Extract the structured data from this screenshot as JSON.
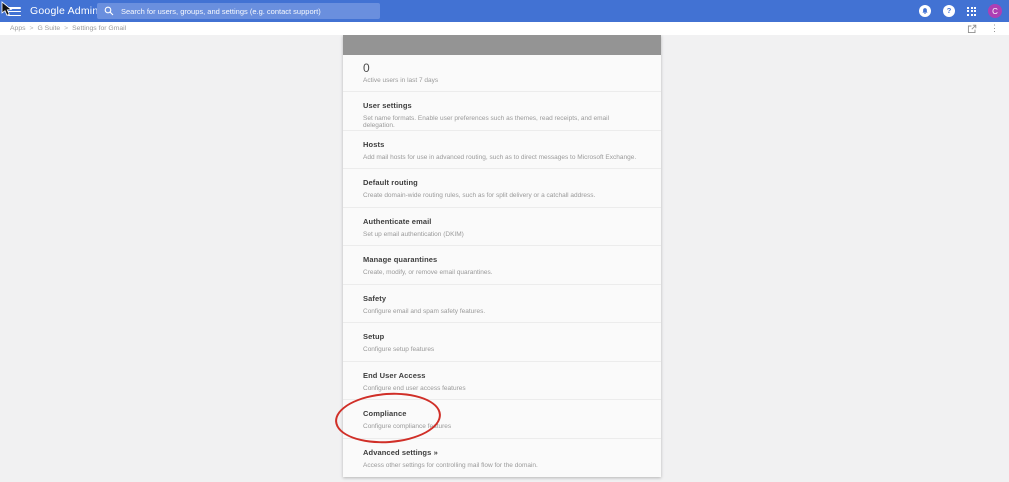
{
  "colors": {
    "header_bg": "#4272d3",
    "search_bg": "#6a8fde",
    "avatar_bg": "#ae3fb4",
    "card_topbar": "#949494",
    "page_bg": "#f1f1f2",
    "card_bg": "#fafafa",
    "annotation": "#d02f28"
  },
  "header": {
    "product_name": "Google Admin",
    "search": {
      "placeholder": "Search for users, groups, and settings (e.g. contact support)"
    },
    "avatar_letter": "C"
  },
  "icons": {
    "help_glyph": "?",
    "kebab_glyph": "⋮"
  },
  "breadcrumb": {
    "separator": ">",
    "items": [
      "Apps",
      "G Suite",
      "Settings for Gmail"
    ]
  },
  "stats": {
    "value": "0",
    "label": "Active users in last 7 days"
  },
  "sections": [
    {
      "id": "user-settings",
      "title": "User settings",
      "description": "Set name formats. Enable user preferences such as themes, read receipts, and email delegation.",
      "annotated": false
    },
    {
      "id": "hosts",
      "title": "Hosts",
      "description": "Add mail hosts for use in advanced routing, such as to direct messages to Microsoft Exchange.",
      "annotated": false
    },
    {
      "id": "default-routing",
      "title": "Default routing",
      "description": "Create domain-wide routing rules, such as for split delivery or a catchall address.",
      "annotated": false
    },
    {
      "id": "authenticate-email",
      "title": "Authenticate email",
      "description": "Set up email authentication (DKIM)",
      "annotated": false
    },
    {
      "id": "manage-quarantines",
      "title": "Manage quarantines",
      "description": "Create, modify, or remove email quarantines.",
      "annotated": false
    },
    {
      "id": "safety",
      "title": "Safety",
      "description": "Configure email and spam safety features.",
      "annotated": false
    },
    {
      "id": "setup",
      "title": "Setup",
      "description": "Configure setup features",
      "annotated": false
    },
    {
      "id": "end-user-access",
      "title": "End User Access",
      "description": "Configure end user access features",
      "annotated": false
    },
    {
      "id": "compliance",
      "title": "Compliance",
      "description": "Configure compliance features",
      "annotated": true
    },
    {
      "id": "advanced-settings",
      "title": "Advanced settings »",
      "description": "Access other settings for controlling mail flow for the domain.",
      "annotated": false
    }
  ]
}
